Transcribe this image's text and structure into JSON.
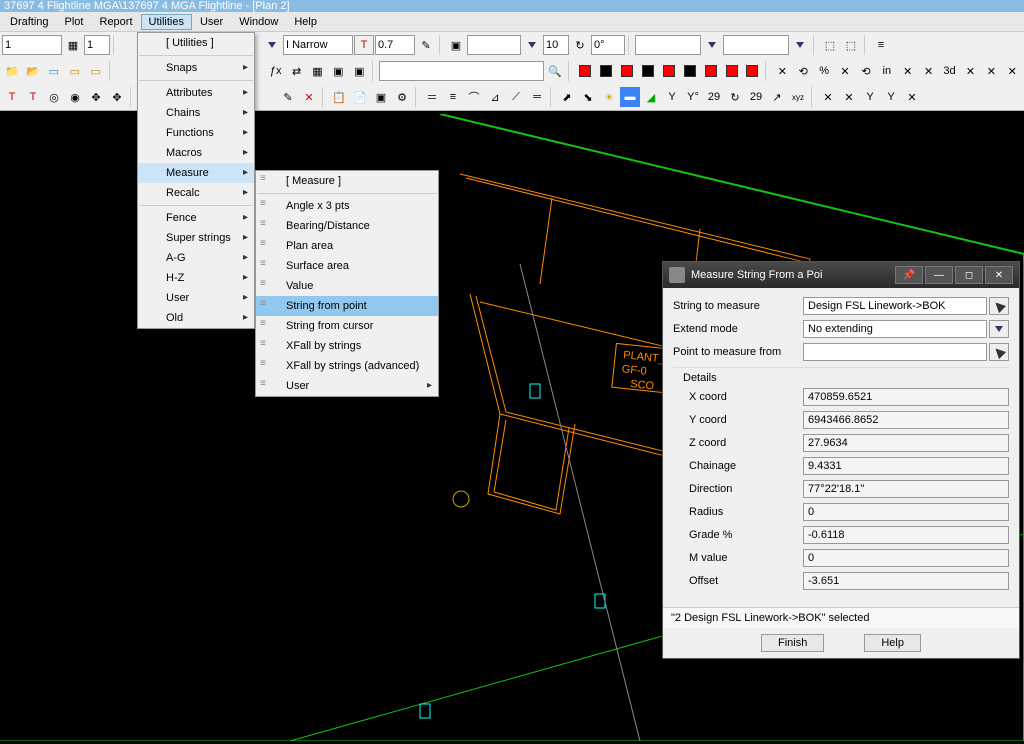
{
  "title": "37697 4 Flightline MGA\\137697 4 MGA Flightline  - [Plan 2]",
  "menubar": [
    "Drafting",
    "Plot",
    "Report",
    "Utilities",
    "User",
    "Window",
    "Help"
  ],
  "active_menu": "Utilities",
  "toolbar1": {
    "val1": "1",
    "val2": "1",
    "narrow": "I Narrow",
    "t_val": "0.7",
    "sp_val": "10",
    "angle": "0°"
  },
  "utilities_menu": [
    {
      "label": "[ Utilities ]"
    },
    {
      "sep": true
    },
    {
      "label": "Snaps",
      "arrow": true
    },
    {
      "sep": true
    },
    {
      "label": "Attributes",
      "arrow": true
    },
    {
      "label": "Chains",
      "arrow": true
    },
    {
      "label": "Functions",
      "arrow": true
    },
    {
      "label": "Macros",
      "arrow": true
    },
    {
      "label": "Measure",
      "arrow": true,
      "highlighted": true
    },
    {
      "label": "Recalc",
      "arrow": true
    },
    {
      "sep": true
    },
    {
      "label": "Fence",
      "arrow": true
    },
    {
      "label": "Super strings",
      "arrow": true
    },
    {
      "label": "A-G",
      "arrow": true
    },
    {
      "label": "H-Z",
      "arrow": true
    },
    {
      "label": "User",
      "arrow": true
    },
    {
      "label": "Old",
      "arrow": true
    }
  ],
  "measure_submenu": [
    {
      "label": "[ Measure ]"
    },
    {
      "sep": true
    },
    {
      "label": "Angle x 3 pts"
    },
    {
      "label": "Bearing/Distance"
    },
    {
      "label": "Plan area"
    },
    {
      "label": "Surface area"
    },
    {
      "label": "Value"
    },
    {
      "label": "String from point",
      "highlighted": true
    },
    {
      "label": "String from cursor"
    },
    {
      "label": "XFall by strings"
    },
    {
      "label": "XFall by strings (advanced)"
    },
    {
      "label": "User",
      "arrow": true
    }
  ],
  "dialog": {
    "title": "Measure String From a Poi",
    "string_to_measure_label": "String to measure",
    "string_to_measure": "Design FSL Linework->BOK",
    "extend_mode_label": "Extend mode",
    "extend_mode": "No extending",
    "point_label": "Point to measure from",
    "point_value": "",
    "details_label": "Details",
    "rows": {
      "xcoord": {
        "label": "X coord",
        "value": "470859.6521"
      },
      "ycoord": {
        "label": "Y coord",
        "value": "6943466.8652"
      },
      "zcoord": {
        "label": "Z coord",
        "value": "27.9634"
      },
      "chainage": {
        "label": "Chainage",
        "value": "9.4331"
      },
      "direction": {
        "label": "Direction",
        "value": "77°22'18.1\""
      },
      "radius": {
        "label": "Radius",
        "value": "0"
      },
      "grade": {
        "label": "Grade %",
        "value": "-0.6118"
      },
      "mvalue": {
        "label": "M value",
        "value": "0"
      },
      "offset": {
        "label": "Offset",
        "value": "-3.651"
      }
    },
    "status": "\"2 Design FSL Linework->BOK\" selected",
    "finish": "Finish",
    "help": "Help"
  },
  "canvas_text": {
    "line1": "PLANT_R",
    "line2": "GF-0",
    "line3": "SCO"
  }
}
